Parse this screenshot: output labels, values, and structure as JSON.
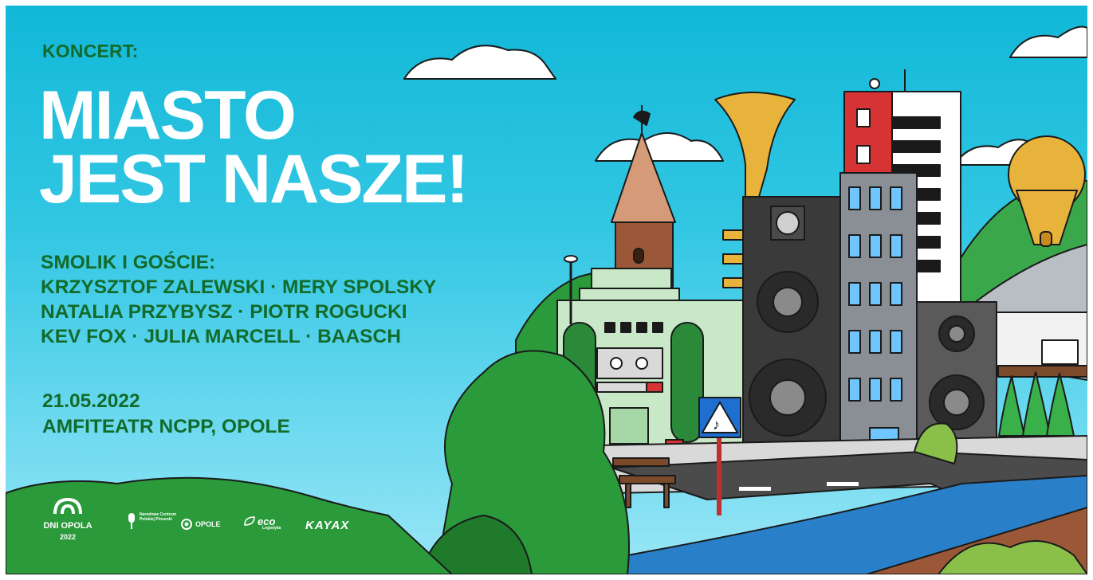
{
  "header": {
    "label": "KONCERT:"
  },
  "title": {
    "line1": "MIASTO",
    "line2": "JEST NASZE!"
  },
  "lineup": {
    "heading": "SMOLIK I GOŚCIE:",
    "line1": "KRZYSZTOF ZALEWSKI · MERY SPOLSKY",
    "line2": "NATALIA PRZYBYSZ · PIOTR ROGUCKI",
    "line3": "KEV FOX · JULIA MARCELL · BAASCH"
  },
  "event": {
    "date": "21.05.2022",
    "venue": "AMFITEATR NCPP, OPOLE"
  },
  "logos": {
    "dni_opola": {
      "name": "DNI OPOLA",
      "year": "2022"
    },
    "ncpp": {
      "text": "Narodowe Centrum Polskiej Piosenki"
    },
    "opole": {
      "text": "OPOLE"
    },
    "eco": {
      "text": "eco",
      "sub": "Logistyka"
    },
    "kayax": {
      "text": "KAYAX"
    }
  },
  "colors": {
    "sky": "#1bbcdc",
    "text_green": "#126b2a",
    "title_white": "#ffffff",
    "hill_green": "#2a9a3a"
  }
}
